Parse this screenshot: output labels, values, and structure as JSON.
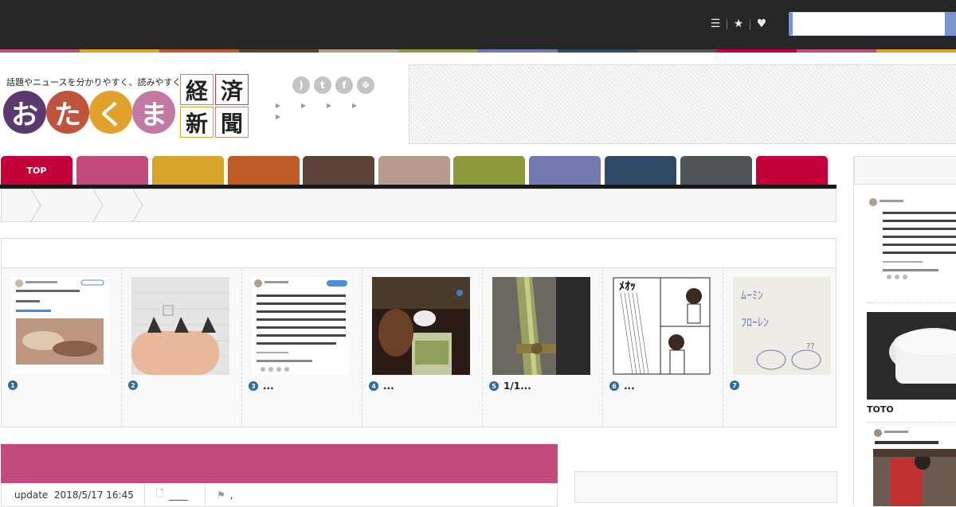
{
  "header": {
    "icons": [
      "list-icon",
      "star-icon",
      "heart-icon"
    ],
    "search": {
      "placeholder": "",
      "value": ""
    }
  },
  "stripe_colors": [
    "#c44a7c",
    "#d8a62a",
    "#c05a26",
    "#5b4338",
    "#b89a8e",
    "#8e9a3a",
    "#7478b0",
    "#2f4a66",
    "#4f5458",
    "#c4003a",
    "#c44a7c",
    "#d8a62a"
  ],
  "site": {
    "tagline": "話題やニュースを分かりやすく、読みやすく。",
    "logo_chars": [
      "お",
      "た",
      "く",
      "ま"
    ],
    "logo_colors": [
      "#5a3a6e",
      "#c0533e",
      "#e0a22a",
      "#c27aa4"
    ],
    "kanji": [
      "経",
      "済",
      "新",
      "聞"
    ]
  },
  "social": [
    "rss-icon",
    "twitter-icon",
    "facebook-icon",
    "feedly-icon"
  ],
  "nav": {
    "tabs": [
      {
        "label": "TOP",
        "color": "#c4003a"
      },
      {
        "label": "",
        "color": "#c44a7c"
      },
      {
        "label": "",
        "color": "#d8a62a"
      },
      {
        "label": "",
        "color": "#c05a26"
      },
      {
        "label": "",
        "color": "#5b4338"
      },
      {
        "label": "",
        "color": "#b89a8e"
      },
      {
        "label": "",
        "color": "#8e9a3a"
      },
      {
        "label": "",
        "color": "#7478b0"
      },
      {
        "label": "",
        "color": "#2f4a66"
      },
      {
        "label": "",
        "color": "#4f5458"
      },
      {
        "label": "",
        "color": "#c4003a"
      }
    ]
  },
  "ranking": {
    "items": [
      {
        "rank": "1",
        "title": ""
      },
      {
        "rank": "2",
        "title": ""
      },
      {
        "rank": "3",
        "title": "..."
      },
      {
        "rank": "4",
        "title": "..."
      },
      {
        "rank": "5",
        "title": "1/1..."
      },
      {
        "rank": "6",
        "title": "..."
      },
      {
        "rank": "7",
        "title": ""
      }
    ]
  },
  "article": {
    "update_label": "update",
    "update_value": "2018/5/17 16:45",
    "category": "____",
    "tags": ","
  },
  "sidebar": {
    "item_label": "TOTO"
  }
}
